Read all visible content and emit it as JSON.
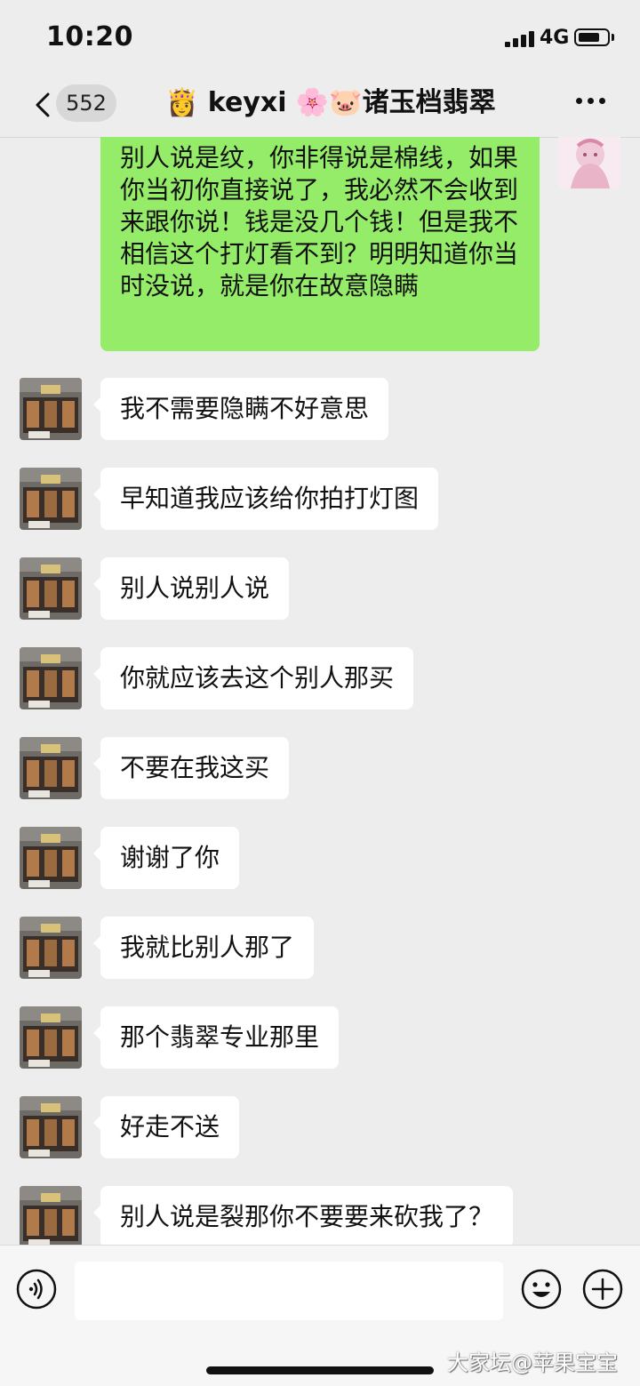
{
  "status_bar": {
    "time": "10:20",
    "network": "4G",
    "battery_percent": 75
  },
  "nav": {
    "unread_count": "552",
    "title": "👸 keyxi 🌸🐷诸玉档翡翠",
    "back_icon": "chevron-left-icon",
    "more_icon": "ellipsis-icon"
  },
  "messages": [
    {
      "sender": "self",
      "text": "别人说是纹，你非得说是棉线，如果你当初你直接说了，我必然不会收到来跟你说！钱是没几个钱！但是我不相信这个打灯看不到？明明知道你当时没说，就是你在故意隐瞒"
    },
    {
      "sender": "other",
      "text": "我不需要隐瞒不好意思"
    },
    {
      "sender": "other",
      "text": "早知道我应该给你拍打灯图"
    },
    {
      "sender": "other",
      "text": "别人说别人说"
    },
    {
      "sender": "other",
      "text": "你就应该去这个别人那买"
    },
    {
      "sender": "other",
      "text": "不要在我这买"
    },
    {
      "sender": "other",
      "text": "谢谢了你"
    },
    {
      "sender": "other",
      "text": "我就比别人那了"
    },
    {
      "sender": "other",
      "text": "那个翡翠专业那里"
    },
    {
      "sender": "other",
      "text": "好走不送"
    },
    {
      "sender": "other",
      "text": "别人说是裂那你不要要来砍我了？"
    }
  ],
  "input_bar": {
    "placeholder": "",
    "voice_icon": "voice-icon",
    "emoji_icon": "emoji-icon",
    "plus_icon": "plus-icon"
  },
  "watermark": "大家坛@苹果宝宝",
  "colors": {
    "background": "#ededed",
    "self_bubble": "#95ec69",
    "other_bubble": "#ffffff"
  }
}
